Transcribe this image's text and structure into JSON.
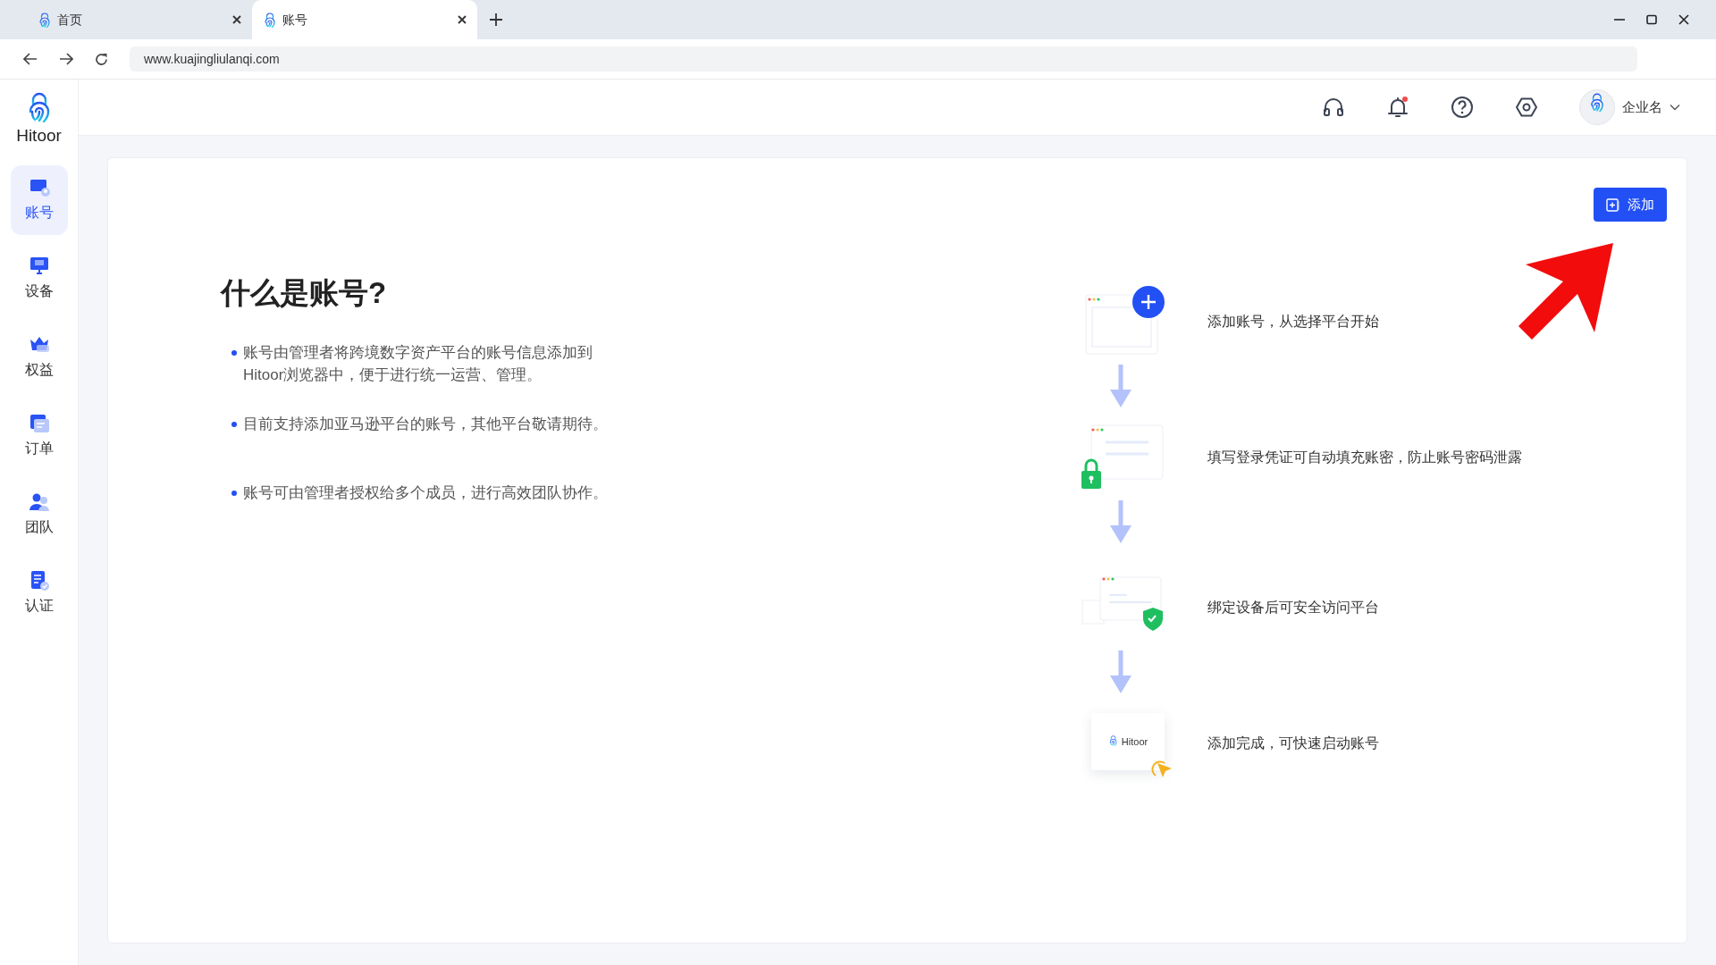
{
  "browser": {
    "tabs": [
      {
        "label": "首页",
        "selected": false
      },
      {
        "label": "账号",
        "selected": true
      }
    ],
    "url": "www.kuajingliulanqi.com"
  },
  "sidebar": {
    "logo": "Hitoor",
    "items": [
      {
        "label": "账号",
        "kind": "account",
        "selected": true
      },
      {
        "label": "设备",
        "kind": "device",
        "selected": false
      },
      {
        "label": "权益",
        "kind": "crown",
        "selected": false
      },
      {
        "label": "订单",
        "kind": "order",
        "selected": false
      },
      {
        "label": "团队",
        "kind": "team",
        "selected": false
      },
      {
        "label": "认证",
        "kind": "cert",
        "selected": false
      }
    ]
  },
  "header": {
    "org_name": "企业名",
    "notification_dot": true
  },
  "add_button": "添加",
  "intro": {
    "title": "什么是账号?",
    "bullets": [
      "账号由管理者将跨境数字资产平台的账号信息添加到Hitoor浏览器中，便于进行统一运营、管理。",
      "目前支持添加亚马逊平台的账号，其他平台敬请期待。",
      "账号可由管理者授权给多个成员，进行高效团队协作。"
    ]
  },
  "steps": [
    {
      "kind": "add",
      "text": "添加账号，从选择平台开始"
    },
    {
      "kind": "credentials",
      "text": "填写登录凭证可自动填充账密，防止账号密码泄露"
    },
    {
      "kind": "device",
      "text": "绑定设备后可安全访问平台"
    },
    {
      "kind": "launch",
      "text": "添加完成，可快速启动账号",
      "logo": "Hitoor"
    }
  ]
}
